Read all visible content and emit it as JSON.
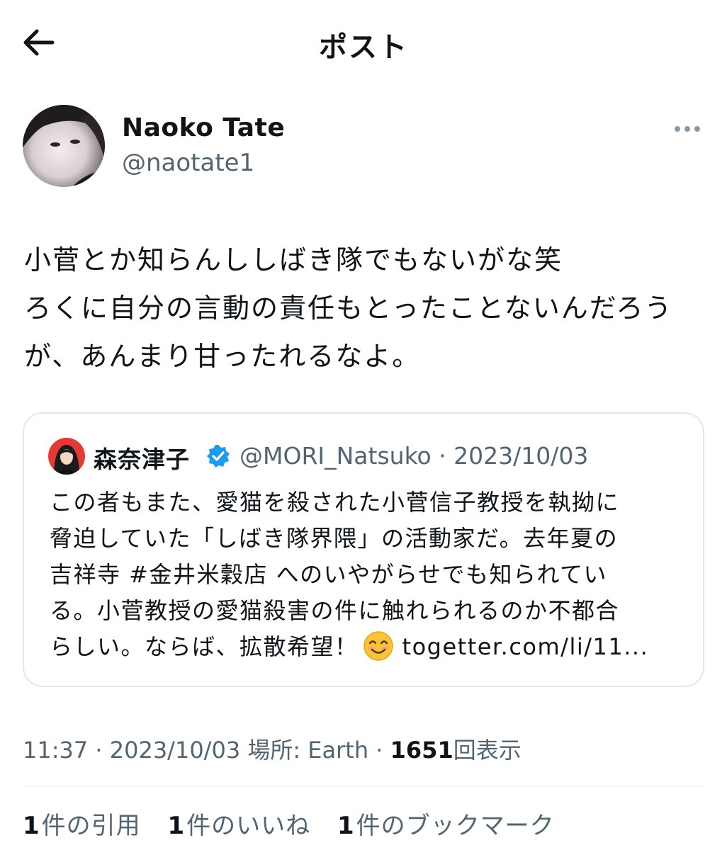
{
  "header": {
    "title": "ポスト"
  },
  "author": {
    "display_name": "Naoko Tate",
    "handle": "@naotate1"
  },
  "tweet": {
    "lines": [
      "小菅とか知らんししばき隊でもないがな笑",
      "ろくに自分の言動の責任もとったことないんだろう",
      "が、あんまり甘ったれるなよ。"
    ]
  },
  "quote": {
    "name": "森奈津子",
    "verified_color": "#1d9bf0",
    "meta": "@MORI_Natsuko · 2023/10/03",
    "lines": [
      "この者もまた、愛猫を殺された小菅信子教授を執拗に",
      "脅迫していた「しばき隊界隈」の活動家だ。去年夏の",
      "吉祥寺 #金井米穀店 へのいやがらせでも知られてい",
      "る。小菅教授の愛猫殺害の件に触れられるのか不都合"
    ],
    "last_line_before": "らしい。ならば、拡散希望！",
    "emoji": "smiling-face-emoji",
    "link": "togetter.com/li/11..."
  },
  "meta": {
    "time_date": "11:37 · 2023/10/03",
    "location": "場所: Earth",
    "separator": "·",
    "views_count": "1651",
    "views_label": "回表示"
  },
  "stats": [
    {
      "count": "1",
      "label": "件の引用"
    },
    {
      "count": "1",
      "label": "件のいいね"
    },
    {
      "count": "1",
      "label": "件のブックマーク"
    }
  ],
  "colors": {
    "text": "#0f1419",
    "secondary": "#536471",
    "border": "#e3e7ea",
    "accent": "#1d9bf0"
  },
  "icons": {
    "back": "arrow-left-icon",
    "more": "more-horizontal-icon",
    "verified": "verified-badge-icon"
  }
}
